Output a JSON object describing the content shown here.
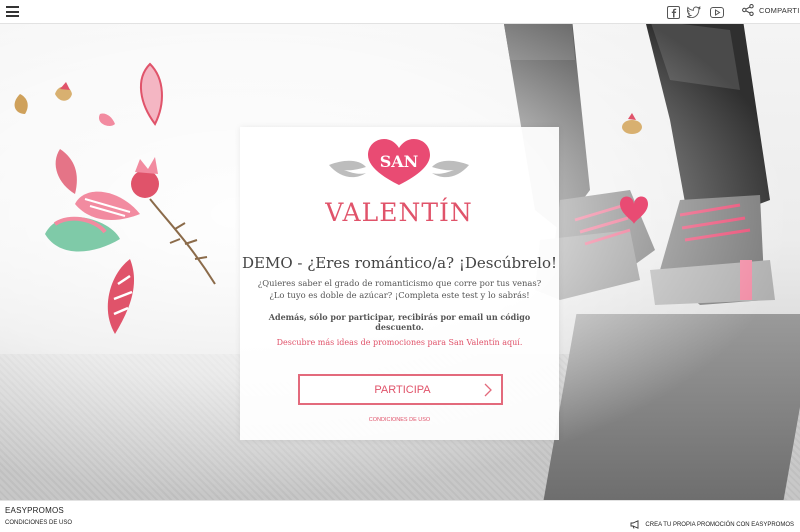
{
  "header": {
    "share_label": "COMPARTIR"
  },
  "card": {
    "logo_top": "SAN",
    "logo_bottom": "VALENTÍN",
    "title": "DEMO - ¿Eres romántico/a? ¡Descúbrelo!",
    "description": "¿Quieres saber el grado de romanticismo que corre por tus venas? ¿Lo tuyo es doble de azúcar? ¡Completa este test y lo sabrás!",
    "note": "Además, sólo por participar, recibirás por email un código descuento.",
    "link": "Descubre más ideas de promociones para San Valentín aquí.",
    "button_label": "PARTICIPA",
    "conditions": "CONDICIONES DE USO"
  },
  "footer": {
    "brand": "EASYPROMOS",
    "conditions": "CONDICIONES DE USO",
    "promo": "CREA TU PROPIA PROMOCIÓN CON EASYPROMOS"
  },
  "colors": {
    "accent": "#e0536a",
    "button_border": "#e36a7c"
  },
  "icons": [
    "menu-icon",
    "facebook-icon",
    "twitter-icon",
    "youtube-icon",
    "share-icon",
    "chevron-right-icon",
    "megaphone-icon"
  ]
}
